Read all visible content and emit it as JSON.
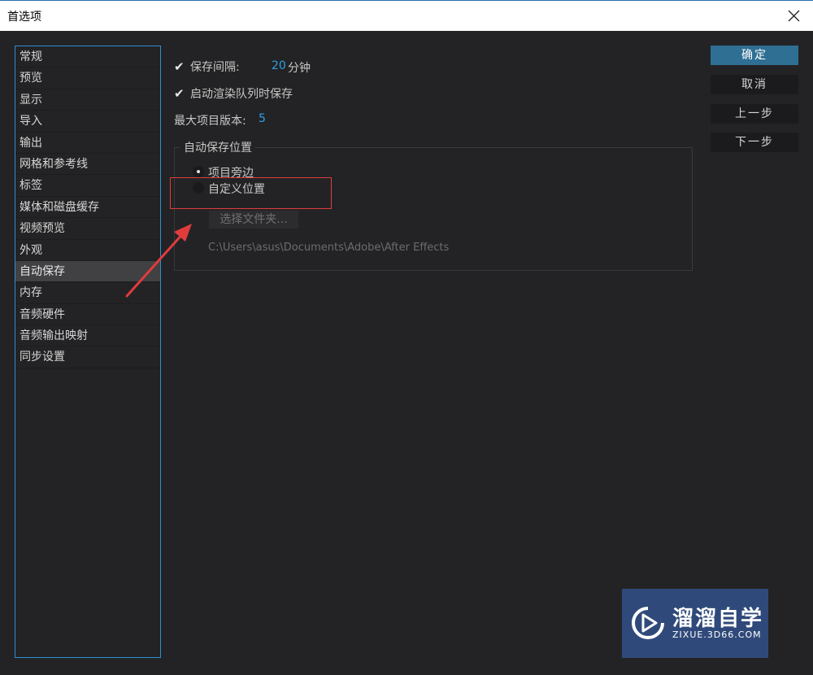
{
  "window": {
    "title": "首选项"
  },
  "sidebar": {
    "items": [
      {
        "label": "常规"
      },
      {
        "label": "预览"
      },
      {
        "label": "显示"
      },
      {
        "label": "导入"
      },
      {
        "label": "输出"
      },
      {
        "label": "网格和参考线"
      },
      {
        "label": "标签"
      },
      {
        "label": "媒体和磁盘缓存"
      },
      {
        "label": "视频预览"
      },
      {
        "label": "外观"
      },
      {
        "label": "自动保存"
      },
      {
        "label": "内存"
      },
      {
        "label": "音频硬件"
      },
      {
        "label": "音频输出映射"
      },
      {
        "label": "同步设置"
      }
    ],
    "active": "自动保存"
  },
  "autosave": {
    "save_interval": {
      "label": "保存间隔:",
      "value": "20",
      "unit": "分钟",
      "checked": true
    },
    "on_render": {
      "label": "启动渲染队列时保存",
      "checked": true
    },
    "max_versions": {
      "label": "最大项目版本:",
      "value": "5"
    },
    "location_group": {
      "title": "自动保存位置",
      "option_project": "项目旁边",
      "option_custom": "自定义位置",
      "selected": "项目旁边",
      "choose_folder": "选择文件夹...",
      "path": "C:\\Users\\asus\\Documents\\Adobe\\After Effects"
    }
  },
  "buttons": {
    "ok": "确定",
    "cancel": "取消",
    "prev": "上一步",
    "next": "下一步"
  },
  "watermark": {
    "name": "溜溜自学",
    "url": "ZIXUE.3D66.COM"
  },
  "colors": {
    "accent": "#2e9ee6",
    "primary_button": "#2f6f93",
    "annotation": "#e03c3c"
  },
  "icons": {
    "close": "close-icon",
    "check": "checkmark-icon",
    "watermark_logo": "play-logo-icon"
  }
}
